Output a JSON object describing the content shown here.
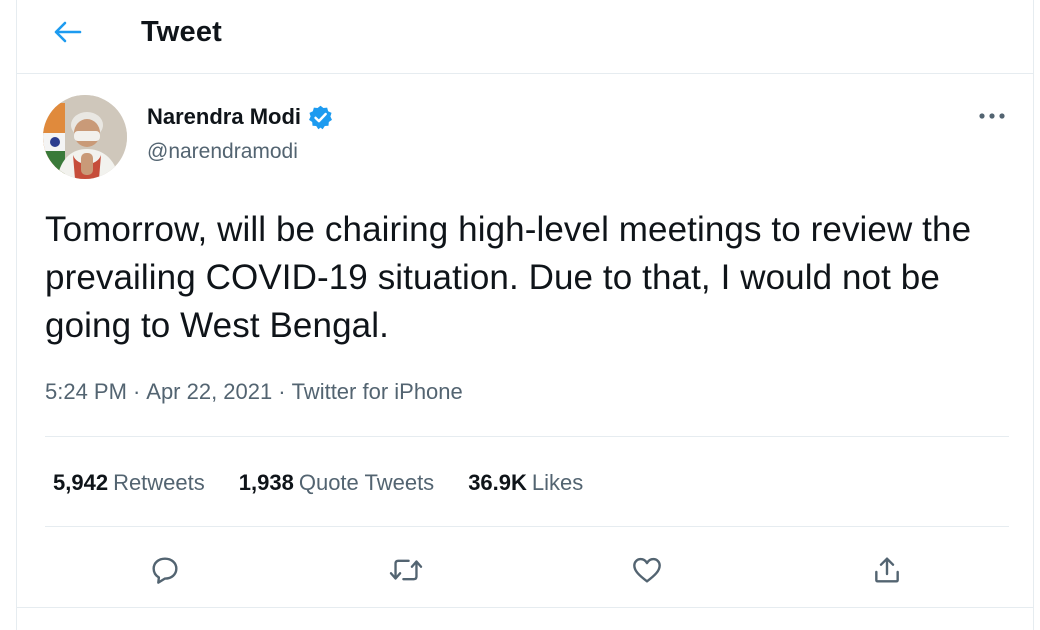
{
  "header": {
    "title": "Tweet",
    "back_icon": "arrow-left-icon"
  },
  "author": {
    "name": "Narendra Modi",
    "handle": "@narendramodi",
    "verified_icon": "verified-badge-icon",
    "more_icon": "more-horizontal-icon"
  },
  "tweet": {
    "text": "Tomorrow, will be chairing high-level meetings to review the prevailing COVID-19 situation. Due to that, I would not be going to West Bengal.",
    "time": "5:24 PM",
    "date": "Apr 22, 2021",
    "source": "Twitter for iPhone",
    "separator": "·"
  },
  "stats": {
    "retweets_count": "5,942",
    "retweets_label": "Retweets",
    "quotes_count": "1,938",
    "quotes_label": "Quote Tweets",
    "likes_count": "36.9K",
    "likes_label": "Likes"
  },
  "actions": {
    "reply_icon": "reply-icon",
    "retweet_icon": "retweet-icon",
    "like_icon": "heart-icon",
    "share_icon": "share-icon"
  },
  "colors": {
    "accent": "#1d9bf0",
    "text": "#0f1419",
    "secondary": "#536471",
    "border": "#e6ecf0"
  }
}
